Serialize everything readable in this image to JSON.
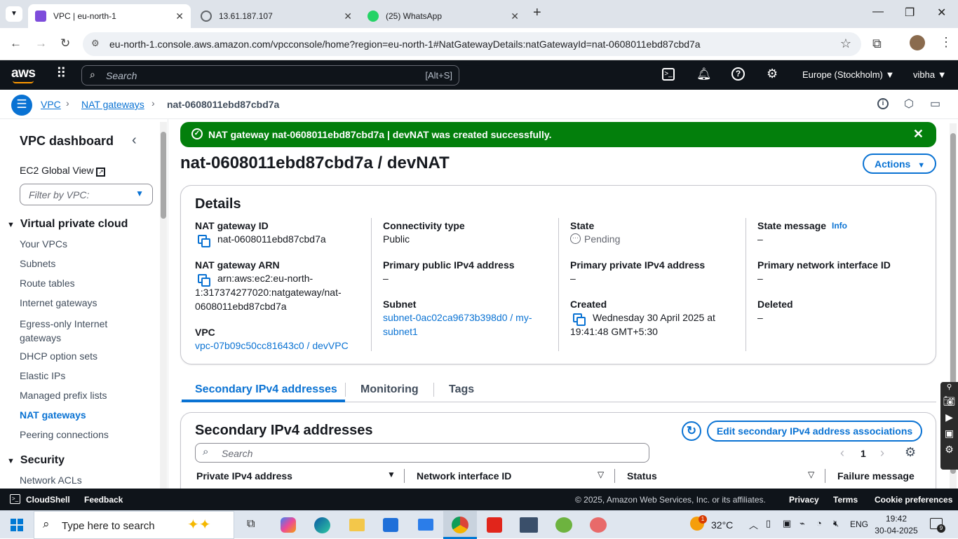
{
  "browser": {
    "tabs": [
      {
        "title": "VPC | eu-north-1",
        "active": true
      },
      {
        "title": "13.61.187.107",
        "active": false
      },
      {
        "title": "(25) WhatsApp",
        "active": false
      }
    ],
    "url": "eu-north-1.console.aws.amazon.com/vpcconsole/home?region=eu-north-1#NatGatewayDetails:natGatewayId=nat-0608011ebd87cbd7a"
  },
  "aws_header": {
    "logo": "aws",
    "search_placeholder": "Search",
    "search_shortcut": "[Alt+S]",
    "region": "Europe (Stockholm)",
    "user": "vibha"
  },
  "breadcrumb": {
    "items": [
      "VPC",
      "NAT gateways",
      "nat-0608011ebd87cbd7a"
    ]
  },
  "sidebar": {
    "title": "VPC dashboard",
    "global_view": "EC2 Global View",
    "filter_placeholder": "Filter by VPC:",
    "section_vpc": "Virtual private cloud",
    "items": [
      "Your VPCs",
      "Subnets",
      "Route tables",
      "Internet gateways",
      "Egress-only Internet gateways",
      "DHCP option sets",
      "Elastic IPs",
      "Managed prefix lists",
      "NAT gateways",
      "Peering connections"
    ],
    "active_item": "NAT gateways",
    "section_security": "Security",
    "security_items": [
      "Network ACLs"
    ]
  },
  "flash": {
    "message": "NAT gateway nat-0608011ebd87cbd7a | devNAT was created successfully."
  },
  "page": {
    "title": "nat-0608011ebd87cbd7a / devNAT",
    "actions_label": "Actions"
  },
  "details": {
    "heading": "Details",
    "nat_gateway_id_label": "NAT gateway ID",
    "nat_gateway_id": "nat-0608011ebd87cbd7a",
    "nat_gateway_arn_label": "NAT gateway ARN",
    "nat_gateway_arn_line1": "arn:aws:ec2:eu-north-",
    "nat_gateway_arn_line2": "1:317374277020:natgateway/nat-",
    "nat_gateway_arn_line3": "0608011ebd87cbd7a",
    "vpc_label": "VPC",
    "vpc": "vpc-07b09c50cc81643c0 / devVPC",
    "connectivity_type_label": "Connectivity type",
    "connectivity_type": "Public",
    "primary_public_ipv4_label": "Primary public IPv4 address",
    "primary_public_ipv4": "–",
    "subnet_label": "Subnet",
    "subnet_line1": "subnet-0ac02ca9673b398d0 / my-",
    "subnet_line2": "subnet1",
    "state_label": "State",
    "state": "Pending",
    "primary_private_ipv4_label": "Primary private IPv4 address",
    "primary_private_ipv4": "–",
    "created_label": "Created",
    "created_line1": "Wednesday 30 April 2025 at",
    "created_line2": "19:41:48 GMT+5:30",
    "state_message_label": "State message",
    "info_label": "Info",
    "state_message": "–",
    "primary_eni_label": "Primary network interface ID",
    "primary_eni": "–",
    "deleted_label": "Deleted",
    "deleted": "–"
  },
  "tabs": [
    "Secondary IPv4 addresses",
    "Monitoring",
    "Tags"
  ],
  "secondary": {
    "heading": "Secondary IPv4 addresses",
    "edit_button": "Edit secondary IPv4 address associations",
    "search_placeholder": "Search",
    "page_number": "1",
    "columns": [
      "Private IPv4 address",
      "Network interface ID",
      "Status",
      "Failure message"
    ]
  },
  "footer": {
    "cloudshell": "CloudShell",
    "feedback": "Feedback",
    "copyright": "© 2025, Amazon Web Services, Inc. or its affiliates.",
    "links": [
      "Privacy",
      "Terms",
      "Cookie preferences"
    ]
  },
  "taskbar": {
    "search_placeholder": "Type here to search",
    "weather": "32°C",
    "lang": "ENG",
    "time": "19:42",
    "date": "30-04-2025",
    "notifications": "9",
    "weather_badge": "1"
  },
  "colors": {
    "aws_dark": "#0f141a",
    "link": "#0972d3",
    "success": "#037f0c"
  }
}
